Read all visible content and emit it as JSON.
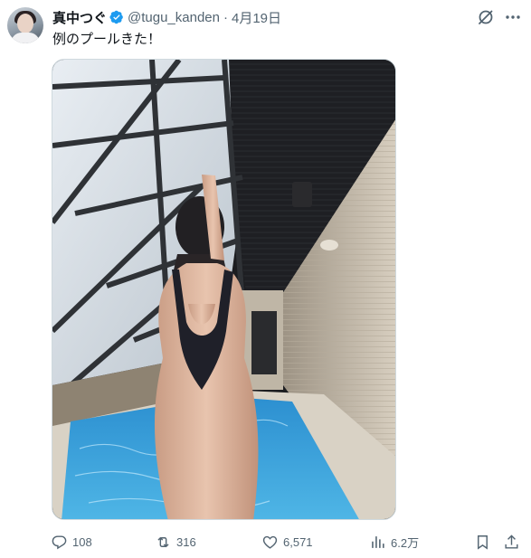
{
  "tweet": {
    "author_name": "真中つぐ",
    "handle": "@tugu_kanden",
    "separator": "·",
    "date": "4月19日",
    "text": "例のプールきた！"
  },
  "icons": {
    "verified": "verified-badge-icon",
    "grok": "grok-icon",
    "more": "more-icon",
    "reply": "reply-icon",
    "retweet": "retweet-icon",
    "like": "like-icon",
    "views": "views-icon",
    "bookmark": "bookmark-icon",
    "share": "share-icon"
  },
  "metrics": {
    "replies": "108",
    "retweets": "316",
    "likes": "6,571",
    "views": "6.2万"
  },
  "colors": {
    "text": "#0f1419",
    "secondary": "#536471",
    "verified": "#1d9bf0",
    "pool_water": "#2f9fd8"
  }
}
